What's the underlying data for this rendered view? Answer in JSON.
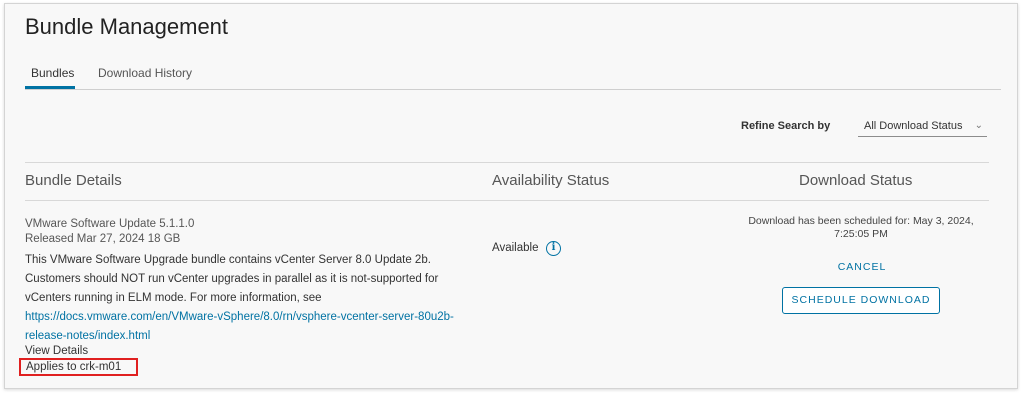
{
  "page": {
    "title": "Bundle Management"
  },
  "tabs": [
    {
      "label": "Bundles",
      "active": true
    },
    {
      "label": "Download History",
      "active": false
    }
  ],
  "filter": {
    "label": "Refine Search by",
    "selected": "All Download Status",
    "icon": "chevron-down-icon"
  },
  "columns": {
    "details": "Bundle Details",
    "availability": "Availability Status",
    "download": "Download Status"
  },
  "bundle": {
    "name": "VMware Software Update 5.1.1.0",
    "released": "Released Mar 27, 2024 18 GB",
    "description": "This VMware Software Upgrade bundle contains vCenter Server 8.0 Update 2b. Customers should NOT run vCenter upgrades in parallel as it is not-supported for vCenters running in ELM mode. For more information, see",
    "link": "https://docs.vmware.com/en/VMware-vSphere/8.0/rn/vsphere-vcenter-server-80u2b-release-notes/index.html",
    "view_details": "View Details",
    "applies_to": "Applies to crk-m01",
    "availability": "Available",
    "info_icon": "info-icon",
    "download_status": "Download has been scheduled for: May 3, 2024, 7:25:05 PM",
    "cancel_label": "CANCEL",
    "schedule_label": "SCHEDULE DOWNLOAD"
  },
  "colors": {
    "accent": "#0072a3",
    "highlight_box": "#e02020"
  }
}
